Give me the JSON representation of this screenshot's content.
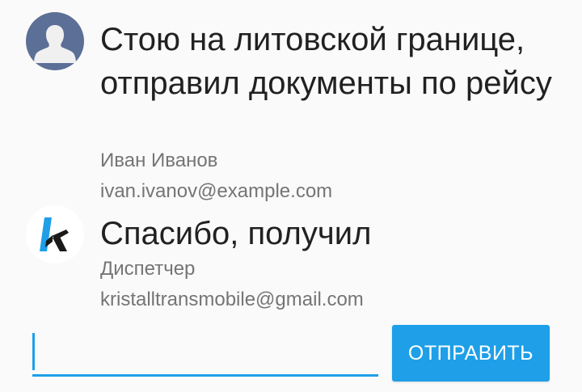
{
  "messages": [
    {
      "avatar": "user-avatar-icon",
      "text": "Стою на литовской границе, отправил документы по рейсу",
      "author": "Иван Иванов",
      "email": "ivan.ivanov@example.com"
    },
    {
      "avatar": "company-logo-icon",
      "text": "Спасибо, получил",
      "author": "Диспетчер",
      "email": "kristalltransmobile@gmail.com"
    }
  ],
  "composer": {
    "input_value": "",
    "send_label": "ОТПРАВИТЬ"
  },
  "colors": {
    "accent": "#1e9fe8",
    "avatar_bg": "#5c6f96",
    "text_primary": "#212121",
    "text_secondary": "#757575"
  }
}
